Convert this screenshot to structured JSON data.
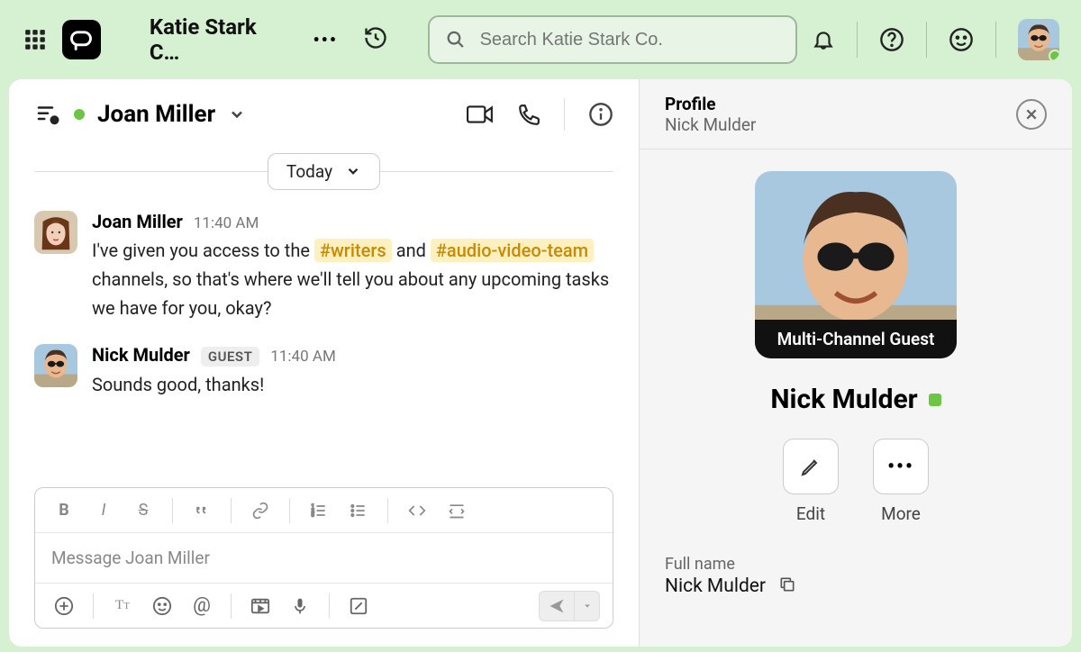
{
  "topbar": {
    "workspace_name": "Katie Stark C…",
    "search_placeholder": "Search Katie Stark Co."
  },
  "chat": {
    "peer_name": "Joan Miller",
    "date_label": "Today",
    "messages": [
      {
        "author": "Joan Miller",
        "time": "11:40 AM",
        "guest": false,
        "body_pre": "I've given you access to the ",
        "tag1": "#writers",
        "body_mid": " and ",
        "tag2": "#audio-video-team",
        "body_post": " channels, so that's where we'll tell you about any upcoming tasks we have for you, okay?"
      },
      {
        "author": "Nick Mulder",
        "time": "11:40 AM",
        "guest": true,
        "guest_label": "GUEST",
        "body": "Sounds good, thanks!"
      }
    ],
    "composer_placeholder": "Message Joan Miller"
  },
  "profile": {
    "header_title": "Profile",
    "header_subtitle": "Nick Mulder",
    "banner": "Multi-Channel Guest",
    "name": "Nick Mulder",
    "actions": {
      "edit": "Edit",
      "more": "More"
    },
    "full_name_label": "Full name",
    "full_name_value": "Nick Mulder"
  }
}
